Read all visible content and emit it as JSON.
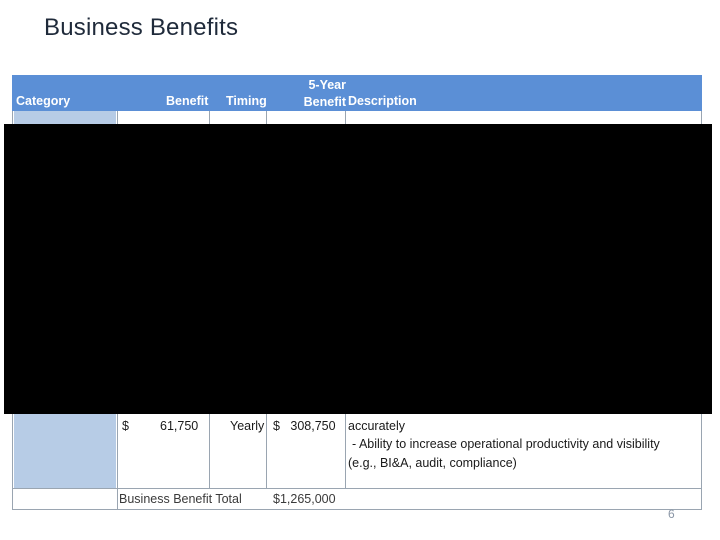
{
  "slide": {
    "title": "Business Benefits",
    "page_number": "6"
  },
  "table": {
    "headers": {
      "category": "Category",
      "benefit": "Benefit",
      "timing": "Timing",
      "five_year_line1": "5-Year",
      "five_year_line2": "Benefit",
      "description": "Description"
    },
    "visible_row": {
      "currency": "$",
      "benefit": "61,750",
      "timing": "Yearly",
      "five_year": "$   308,750",
      "description_lines": [
        "accurately",
        "- Ability to increase operational productivity and visibility",
        "(e.g., BI&A, audit, compliance)"
      ]
    },
    "total": {
      "label": "Business Benefit Total",
      "value": "$1,265,000"
    }
  },
  "colors": {
    "header_bg": "#5b8fd6",
    "category_bg": "#b7cce6",
    "redaction": "#000000"
  }
}
